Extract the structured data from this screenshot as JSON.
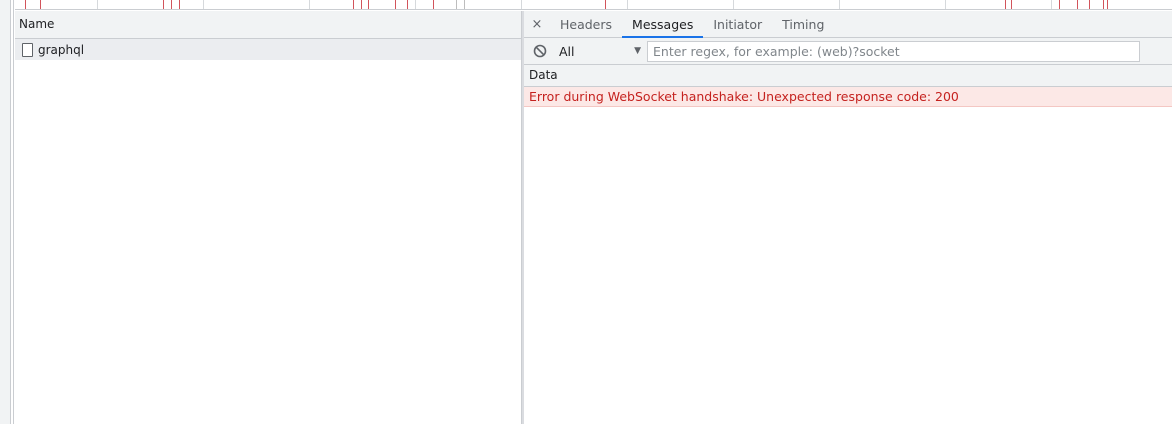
{
  "request_list": {
    "column_header": "Name",
    "rows": [
      {
        "name": "graphql"
      }
    ]
  },
  "detail": {
    "close_glyph": "×",
    "tabs": [
      {
        "label": "Headers",
        "active": false
      },
      {
        "label": "Messages",
        "active": true
      },
      {
        "label": "Initiator",
        "active": false
      },
      {
        "label": "Timing",
        "active": false
      }
    ],
    "filter": {
      "block_icon": "block-icon",
      "select_value": "All",
      "regex_placeholder": "Enter regex, for example: (web)?socket"
    },
    "messages": {
      "column_header": "Data",
      "rows": [
        {
          "text": "Error during WebSocket handshake: Unexpected response code: 200",
          "type": "error"
        }
      ]
    }
  },
  "colors": {
    "accent": "#1a73e8",
    "error_text": "#c5221f",
    "error_bg": "#fce8e6"
  }
}
